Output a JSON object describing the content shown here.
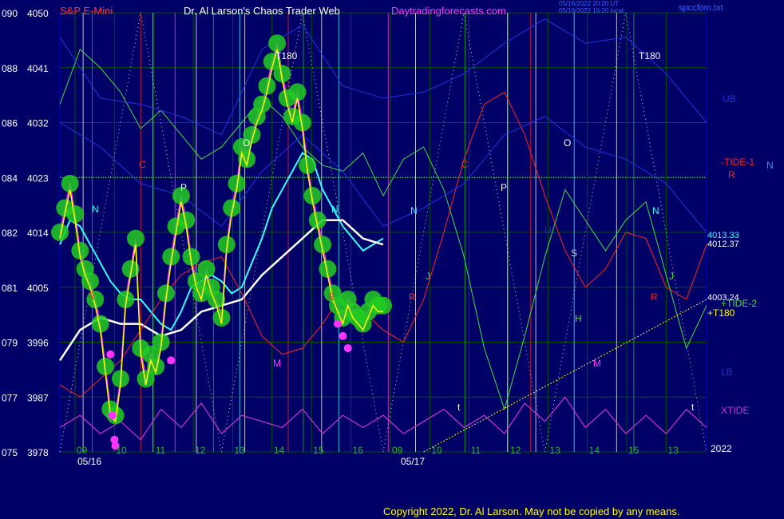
{
  "header": {
    "symbol": "S&P E-Mini",
    "title": "Dr. Al Larson's Chaos Trader Web",
    "site": "Daytradingforecasts.com",
    "stamp_line1": "05/16/2022 20:20 UT",
    "stamp_line2": "05/16/2022 16:20 local",
    "file": "spccfom.txt"
  },
  "footer": {
    "copyright": "Copyright 2022, Dr. Al Larson. May not be copied by any means."
  },
  "colors": {
    "background": "#000066",
    "price_blue": "#1a1aff",
    "grid": "#005500",
    "green_dots": "#22cc22",
    "magenta_dots": "#ff33ff",
    "yellow_line": "#ffff00",
    "cyan_line": "#33ffff",
    "white_line": "#ffffff",
    "tide_green": "#44dd44",
    "tide_red": "#ff2222",
    "xtide_magenta": "#cc33cc",
    "band_blue": "#2233dd",
    "band_green": "#22bb22",
    "labels": "#ffffff",
    "header_red": "#ff3333",
    "header_magenta": "#ff33ff"
  },
  "chart_data": {
    "type": "line",
    "title": "S&P E-Mini",
    "ylabel_pairs": [
      {
        "code": "090",
        "price": "4050"
      },
      {
        "code": "088",
        "price": "4041"
      },
      {
        "code": "086",
        "price": "4032"
      },
      {
        "code": "084",
        "price": "4023"
      },
      {
        "code": "082",
        "price": "4014"
      },
      {
        "code": "081",
        "price": "4005"
      },
      {
        "code": "079",
        "price": "3996"
      },
      {
        "code": "077",
        "price": "3987"
      },
      {
        "code": "075",
        "price": "3978"
      }
    ],
    "ylim": [
      3978,
      4050
    ],
    "x_hour_ticks": [
      "09",
      "10",
      "11",
      "12",
      "13",
      "14",
      "15",
      "16",
      "09",
      "10",
      "11",
      "12",
      "13",
      "14",
      "15",
      "13"
    ],
    "date_labels": [
      "05/16",
      "05/17"
    ],
    "year_label": "2022",
    "price_levels": {
      "cyan_ma_last": "4013.33",
      "white_ma_last": "4012.37",
      "tide2_last": "4003.24"
    },
    "right_labels": {
      "ub": "UB",
      "tide1": "-TIDE-1",
      "r": "R",
      "n": "N",
      "tide2": "+TIDE-2",
      "t180": "+T180",
      "lb": "LB",
      "xtide": "XTIDE"
    },
    "annotations": {
      "t180_a": "T180",
      "t180_b": "T180",
      "o": "O",
      "p": "P",
      "n": "N",
      "r": "R",
      "m": "M",
      "j": "J",
      "h": "H",
      "s": "S",
      "u": "U",
      "t": "t",
      "c": "C"
    },
    "series": [
      {
        "name": "Price",
        "x": [
          0,
          0.5,
          1,
          1.5,
          2,
          2.5,
          3,
          3.5,
          4,
          4.5,
          5,
          5.5,
          6,
          6.5,
          7,
          7.5,
          8,
          8.5,
          9,
          9.5,
          10,
          10.5,
          11,
          11.5,
          12,
          12.5,
          13,
          13.5,
          14,
          14.5,
          15,
          15.5,
          16,
          16.5,
          17,
          17.5,
          18,
          18.5,
          19,
          19.5,
          20,
          20.5,
          21,
          21.5,
          22,
          22.5,
          23,
          23.5,
          24,
          24.5,
          25,
          25.5,
          26,
          26.5,
          27,
          27.5,
          28,
          28.5,
          29,
          29.5,
          30,
          30.5,
          31,
          31.5,
          32
        ],
        "values": [
          4014,
          4018,
          4022,
          4017,
          4011,
          4008,
          4006,
          4003,
          3999,
          3992,
          3985,
          3984,
          3990,
          4003,
          4008,
          4013,
          3995,
          3990,
          3994,
          3992,
          3996,
          4004,
          4010,
          4015,
          4020,
          4016,
          4010,
          4006,
          4004,
          4008,
          4005,
          4003,
          4000,
          4012,
          4018,
          4022,
          4028,
          4026,
          4030,
          4033,
          4035,
          4038,
          4042,
          4045,
          4040,
          4036,
          4033,
          4037,
          4032,
          4025,
          4020,
          4016,
          4012,
          4008,
          4004,
          4002,
          4000,
          4003,
          4001,
          4000,
          3999,
          4001,
          4003,
          4002,
          4002
        ]
      },
      {
        "name": "Cyan MA",
        "x": [
          0,
          1,
          2,
          3,
          4,
          5,
          6,
          7,
          8,
          9,
          10,
          11,
          12,
          13,
          14,
          15,
          16,
          17,
          18,
          19,
          20,
          21,
          22,
          23,
          24,
          25,
          26,
          27,
          28,
          29,
          30,
          31,
          32
        ],
        "values": [
          4012,
          4016,
          4015,
          4012,
          4009,
          4006,
          4004,
          4003,
          4003,
          4001,
          3999,
          3998,
          4001,
          4005,
          4006,
          4007,
          4006,
          4004,
          4005,
          4009,
          4013,
          4018,
          4021,
          4024,
          4027,
          4026,
          4021,
          4018,
          4015,
          4013,
          4011,
          4012,
          4013
        ]
      },
      {
        "name": "White MA",
        "x": [
          0,
          2,
          4,
          6,
          8,
          10,
          12,
          14,
          16,
          18,
          20,
          22,
          24,
          26,
          28,
          30,
          32
        ],
        "values": [
          3993,
          3998,
          4000,
          3999,
          3999,
          3997,
          3998,
          4001,
          4002,
          4003,
          4007,
          4010,
          4013,
          4016,
          4016,
          4013,
          4012
        ]
      },
      {
        "name": "-TIDE-1",
        "x": [
          0,
          2,
          4,
          6,
          8,
          10,
          12,
          14,
          16,
          18,
          20,
          22,
          24,
          26,
          28,
          30,
          32,
          34,
          36,
          38,
          40,
          42,
          44,
          46,
          48,
          50,
          52,
          54,
          56,
          58,
          60,
          62,
          64
        ],
        "values": [
          3989,
          3987,
          3990,
          3993,
          3998,
          4003,
          4007,
          4009,
          4010,
          4004,
          3997,
          3994,
          3995,
          3999,
          4004,
          4001,
          3998,
          3996,
          4003,
          4014,
          4026,
          4035,
          4037,
          4030,
          4020,
          4011,
          4005,
          4008,
          4014,
          4013,
          4005,
          4003,
          4012
        ]
      },
      {
        "name": "+TIDE-2",
        "x": [
          0,
          2,
          4,
          6,
          8,
          10,
          12,
          14,
          16,
          18,
          20,
          22,
          24,
          26,
          28,
          30,
          32,
          34,
          36,
          38,
          40,
          42,
          44,
          46,
          48,
          50,
          52,
          54,
          56,
          58,
          60,
          62,
          64
        ],
        "values": [
          4035,
          4044,
          4041,
          4037,
          4031,
          4034,
          4030,
          4026,
          4028,
          4032,
          4036,
          4033,
          4028,
          4025,
          4024,
          4027,
          4020,
          4026,
          4028,
          4021,
          4010,
          3995,
          3985,
          3997,
          4010,
          4021,
          4016,
          4011,
          4016,
          4019,
          4007,
          3995,
          4002
        ]
      },
      {
        "name": "XTIDE",
        "x": [
          0,
          2,
          4,
          6,
          8,
          10,
          12,
          14,
          16,
          18,
          20,
          22,
          24,
          26,
          28,
          30,
          32,
          34,
          36,
          38,
          40,
          42,
          44,
          46,
          48,
          50,
          52,
          54,
          56,
          58,
          60,
          62,
          64
        ],
        "values": [
          3982,
          3984,
          3981,
          3983,
          3980,
          3985,
          3982,
          3986,
          3981,
          3984,
          3983,
          3982,
          3985,
          3981,
          3984,
          3982,
          3984,
          3981,
          3983,
          3985,
          3982,
          3984,
          3981,
          3986,
          3983,
          3987,
          3982,
          3985,
          3981,
          3984,
          3981,
          3985,
          3982
        ]
      },
      {
        "name": "UB",
        "x": [
          0,
          4,
          8,
          12,
          16,
          20,
          24,
          28,
          32,
          36,
          40,
          44,
          48,
          52,
          56,
          60,
          64
        ],
        "values": [
          4046,
          4036,
          4035,
          4033,
          4030,
          4044,
          4048,
          4038,
          4036,
          4037,
          4040,
          4045,
          4049,
          4045,
          4046,
          4040,
          4032
        ]
      },
      {
        "name": "LB",
        "x": [
          0,
          4,
          8,
          12,
          16,
          20,
          24,
          28,
          32,
          36,
          40,
          44,
          48,
          52,
          56,
          60,
          64
        ],
        "values": [
          4032,
          4028,
          4022,
          4020,
          4015,
          4024,
          4030,
          4024,
          4015,
          4018,
          4022,
          4030,
          4033,
          4028,
          4026,
          4022,
          4014
        ]
      },
      {
        "name": "+T180",
        "x": [
          36,
          64
        ],
        "values": [
          3978,
          4003
        ]
      }
    ],
    "green_dot_x": [
      0,
      0.5,
      1,
      1.5,
      2,
      2.5,
      3,
      3.5,
      4,
      4.5,
      5,
      5.5,
      6,
      6.5,
      7,
      7.5,
      8,
      8.5,
      9,
      9.5,
      10,
      10.5,
      11,
      11.5,
      12,
      12.5,
      13,
      13.5,
      14,
      14.5,
      15,
      15.5,
      16,
      16.5,
      17,
      17.5,
      18,
      18.5,
      19,
      19.5,
      20,
      20.5,
      21,
      21.5,
      22,
      22.5,
      23,
      23.5,
      24,
      24.5,
      25,
      25.5,
      26,
      26.5,
      27,
      27.5,
      28,
      28.5,
      29,
      29.5,
      30,
      30.5,
      31,
      31.5,
      32
    ],
    "magenta_dot_points": [
      {
        "x": 5.0,
        "y": 3994
      },
      {
        "x": 5.2,
        "y": 3984
      },
      {
        "x": 5.4,
        "y": 3980
      },
      {
        "x": 5.5,
        "y": 3979
      },
      {
        "x": 11.0,
        "y": 3993
      },
      {
        "x": 27.5,
        "y": 3999
      },
      {
        "x": 28.0,
        "y": 3997
      },
      {
        "x": 28.5,
        "y": 3995
      }
    ],
    "ref_lines": {
      "horizontal_4023": 4023
    }
  }
}
